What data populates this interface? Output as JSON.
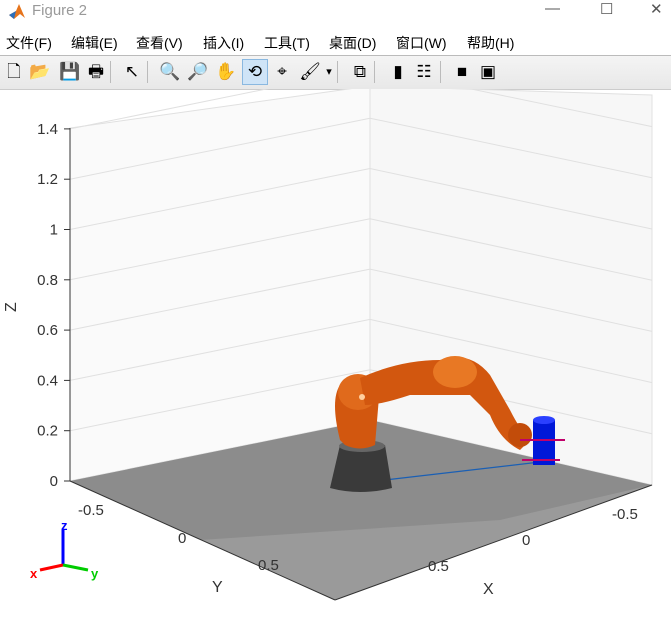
{
  "window": {
    "title": "Figure 2",
    "minimize": "—",
    "maximize": "☐",
    "close": "✕"
  },
  "menu": [
    "文件(F)",
    "编辑(E)",
    "查看(V)",
    "插入(I)",
    "工具(T)",
    "桌面(D)",
    "窗口(W)",
    "帮助(H)"
  ],
  "toolbar": [
    {
      "name": "new-figure-icon",
      "glyph": "🗋"
    },
    {
      "name": "open-icon",
      "glyph": "📂"
    },
    {
      "name": "save-icon",
      "glyph": "💾"
    },
    {
      "name": "print-icon",
      "glyph": "🖶"
    },
    {
      "name": "select-arrow-icon",
      "glyph": "↖"
    },
    {
      "name": "zoom-in-icon",
      "glyph": "🔍"
    },
    {
      "name": "zoom-out-icon",
      "glyph": "🔎"
    },
    {
      "name": "pan-hand-icon",
      "glyph": "✋"
    },
    {
      "name": "rotate-3d-icon",
      "glyph": "⟲"
    },
    {
      "name": "data-cursor-icon",
      "glyph": "⌖"
    },
    {
      "name": "brush-icon",
      "glyph": "🖌"
    },
    {
      "name": "brush-dropdown-icon",
      "glyph": "▾"
    },
    {
      "name": "link-plot-icon",
      "glyph": "⧉"
    },
    {
      "name": "colorbar-icon",
      "glyph": "▮"
    },
    {
      "name": "legend-icon",
      "glyph": "☷"
    },
    {
      "name": "hide-plot-tools-icon",
      "glyph": "■"
    },
    {
      "name": "show-plot-tools-icon",
      "glyph": "▣"
    }
  ],
  "axes": {
    "z_ticks": [
      "0",
      "0.2",
      "0.4",
      "0.6",
      "0.8",
      "1",
      "1.2",
      "1.4"
    ],
    "y_ticks": [
      "-0.5",
      "0",
      "0.5"
    ],
    "x_ticks": [
      "-0.5",
      "0",
      "0.5"
    ],
    "xlabel": "X",
    "ylabel": "Y",
    "zlabel": "Z"
  },
  "triad": {
    "x": "x",
    "y": "y",
    "z": "z",
    "colors": {
      "x": "#ff0000",
      "y": "#00cc00",
      "z": "#0000ff"
    }
  },
  "colors": {
    "robot": "#d2570f",
    "base": "#444444",
    "gripper": "#0018d8",
    "floor": "#8c8c8c"
  }
}
